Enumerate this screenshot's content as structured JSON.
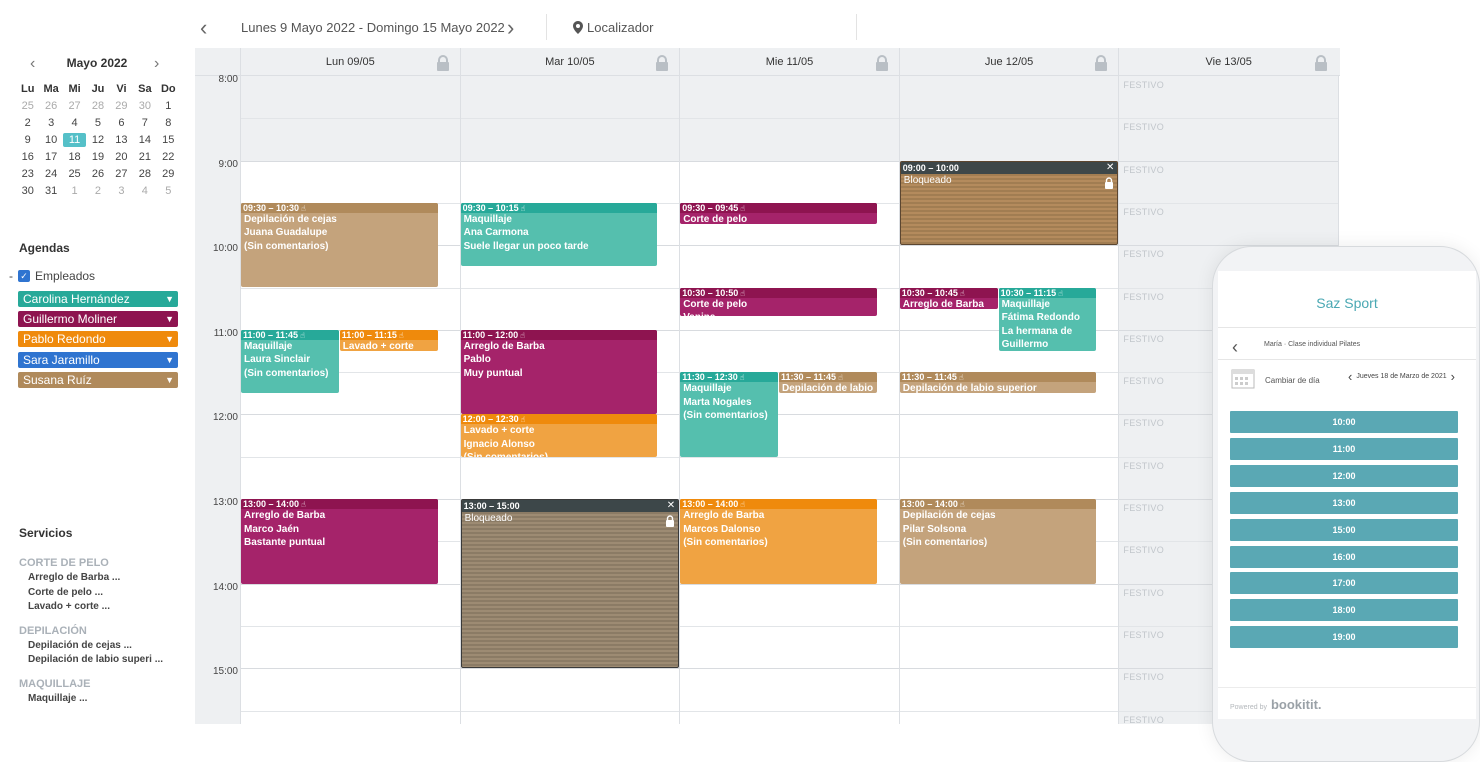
{
  "topbar": {
    "range": "Lunes 9 Mayo 2022 - Domingo 15 Mayo 2022",
    "locator": "Localizador"
  },
  "mini_calendar": {
    "month": "Mayo 2022",
    "weekdays": [
      "Lu",
      "Ma",
      "Mi",
      "Ju",
      "Vi",
      "Sa",
      "Do"
    ],
    "weeks": [
      [
        "25",
        "26",
        "27",
        "28",
        "29",
        "30",
        "1"
      ],
      [
        "2",
        "3",
        "4",
        "5",
        "6",
        "7",
        "8"
      ],
      [
        "9",
        "10",
        "11",
        "12",
        "13",
        "14",
        "15"
      ],
      [
        "16",
        "17",
        "18",
        "19",
        "20",
        "21",
        "22"
      ],
      [
        "23",
        "24",
        "25",
        "26",
        "27",
        "28",
        "29"
      ],
      [
        "30",
        "31",
        "1",
        "2",
        "3",
        "4",
        "5"
      ]
    ],
    "selected": "11"
  },
  "agendas": {
    "title": "Agendas",
    "group_label": "Empleados",
    "employees": [
      {
        "name": "Carolina Hernández",
        "color": "#27a999"
      },
      {
        "name": "Guillermo Moliner",
        "color": "#8e1450"
      },
      {
        "name": "Pablo Redondo",
        "color": "#ef8a0c"
      },
      {
        "name": "Sara Jaramillo",
        "color": "#2f74d0"
      },
      {
        "name": "Susana Ruíz",
        "color": "#b08a5b"
      }
    ]
  },
  "services": {
    "title": "Servicios",
    "categories": [
      {
        "name": "CORTE DE PELO",
        "items": [
          "Arreglo de Barba ...",
          "Corte de pelo ...",
          "Lavado + corte ..."
        ]
      },
      {
        "name": "DEPILACIÓN",
        "items": [
          "Depilación de cejas ...",
          "Depilación de labio superi ..."
        ]
      },
      {
        "name": "MAQUILLAJE",
        "items": [
          "Maquillaje ..."
        ]
      }
    ]
  },
  "calendar": {
    "days": [
      "Lun 09/05",
      "Mar 10/05",
      "Mie 11/05",
      "Jue 12/05",
      "Vie 13/05"
    ],
    "hours": [
      "8:00",
      "9:00",
      "10:00",
      "11:00",
      "12:00",
      "13:00",
      "14:00",
      "15:00"
    ],
    "festivo_label": "FESTIVO",
    "blocked_label": "Bloqueado",
    "events": [
      {
        "day": 0,
        "start": 9.5,
        "end": 10.5,
        "col": 0,
        "cols": 1,
        "time": "09:30 – 10:30",
        "lines": [
          "Depilación de cejas",
          "Juana Guadalupe",
          "(Sin comentarios)"
        ],
        "color": "#c4a37c",
        "head": "#b08a5b"
      },
      {
        "day": 0,
        "start": 11.0,
        "end": 11.75,
        "col": 0,
        "cols": 2,
        "time": "11:00 – 11:45",
        "lines": [
          "Maquillaje",
          "Laura Sinclair",
          "(Sin comentarios)"
        ],
        "color": "#55bfae",
        "head": "#27a999"
      },
      {
        "day": 0,
        "start": 11.0,
        "end": 11.25,
        "col": 1,
        "cols": 2,
        "time": "11:00 – 11:15",
        "lines": [
          "Lavado + corte"
        ],
        "color": "#f0a342",
        "head": "#ef8a0c"
      },
      {
        "day": 0,
        "start": 13.0,
        "end": 14.0,
        "col": 0,
        "cols": 1,
        "time": "13:00 – 14:00",
        "lines": [
          "Arreglo de Barba",
          "Marco Jaén",
          "Bastante puntual"
        ],
        "color": "#a5236a",
        "head": "#8e1450"
      },
      {
        "day": 1,
        "start": 9.5,
        "end": 10.25,
        "col": 0,
        "cols": 1,
        "time": "09:30 – 10:15",
        "lines": [
          "Maquillaje",
          "Ana Carmona",
          "Suele llegar un poco tarde"
        ],
        "color": "#55bfae",
        "head": "#27a999"
      },
      {
        "day": 1,
        "start": 11.0,
        "end": 12.0,
        "col": 0,
        "cols": 1,
        "time": "11:00 – 12:00",
        "lines": [
          "Arreglo de Barba",
          "Pablo",
          "Muy puntual"
        ],
        "color": "#a5236a",
        "head": "#8e1450"
      },
      {
        "day": 1,
        "start": 12.0,
        "end": 12.5,
        "col": 0,
        "cols": 1,
        "time": "12:00 – 12:30",
        "lines": [
          "Lavado + corte",
          "Ignacio Alonso",
          "(Sin comentarios)"
        ],
        "color": "#f0a342",
        "head": "#ef8a0c"
      },
      {
        "day": 2,
        "start": 9.5,
        "end": 9.75,
        "col": 0,
        "cols": 1,
        "time": "09:30 – 09:45",
        "lines": [
          "Corte de pelo"
        ],
        "color": "#a5236a",
        "head": "#8e1450"
      },
      {
        "day": 2,
        "start": 10.5,
        "end": 10.833,
        "col": 0,
        "cols": 1,
        "time": "10:30 – 10:50",
        "lines": [
          "Corte de pelo",
          "Vanina"
        ],
        "color": "#a5236a",
        "head": "#8e1450"
      },
      {
        "day": 2,
        "start": 11.5,
        "end": 12.5,
        "col": 0,
        "cols": 2,
        "time": "11:30 – 12:30",
        "lines": [
          "Maquillaje",
          "Marta Nogales",
          "(Sin comentarios)"
        ],
        "color": "#55bfae",
        "head": "#27a999"
      },
      {
        "day": 2,
        "start": 11.5,
        "end": 11.75,
        "col": 1,
        "cols": 2,
        "time": "11:30 – 11:45",
        "lines": [
          "Depilación de labio"
        ],
        "color": "#c4a37c",
        "head": "#b08a5b"
      },
      {
        "day": 2,
        "start": 13.0,
        "end": 14.0,
        "col": 0,
        "cols": 1,
        "time": "13:00 – 14:00",
        "lines": [
          "Arreglo de Barba",
          "Marcos Dalonso",
          "(Sin comentarios)"
        ],
        "color": "#f0a342",
        "head": "#ef8a0c"
      },
      {
        "day": 3,
        "start": 10.5,
        "end": 10.75,
        "col": 0,
        "cols": 2,
        "time": "10:30 – 10:45",
        "lines": [
          "Arreglo de Barba"
        ],
        "color": "#a5236a",
        "head": "#8e1450"
      },
      {
        "day": 3,
        "start": 10.5,
        "end": 11.25,
        "col": 1,
        "cols": 2,
        "time": "10:30 – 11:15",
        "lines": [
          "Maquillaje",
          "Fátima Redondo",
          "La hermana de",
          "Guillermo"
        ],
        "color": "#55bfae",
        "head": "#27a999"
      },
      {
        "day": 3,
        "start": 11.5,
        "end": 11.75,
        "col": 0,
        "cols": 1,
        "time": "11:30 – 11:45",
        "lines": [
          "Depilación de labio superior"
        ],
        "color": "#c4a37c",
        "head": "#b08a5b"
      },
      {
        "day": 3,
        "start": 13.0,
        "end": 14.0,
        "col": 0,
        "cols": 1,
        "time": "13:00 – 14:00",
        "lines": [
          "Depilación de cejas",
          "Pilar Solsona",
          "(Sin comentarios)"
        ],
        "color": "#c4a37c",
        "head": "#b08a5b"
      }
    ],
    "blocks": [
      {
        "day": 3,
        "start": 9.0,
        "end": 10.0,
        "time": "09:00 – 10:00",
        "style": "blk"
      },
      {
        "day": 1,
        "start": 13.0,
        "end": 15.0,
        "time": "13:00 – 15:00",
        "style": "blk2"
      }
    ]
  },
  "phone": {
    "brand": "Saz Sport",
    "breadcrumb": "María · Clase individual Pilates",
    "change_day": "Cambiar de día",
    "date": "Jueves 18 de Marzo de 2021",
    "slots": [
      "10:00",
      "11:00",
      "12:00",
      "13:00",
      "15:00",
      "16:00",
      "17:00",
      "18:00",
      "19:00"
    ],
    "powered_by": "Powered by",
    "powered_brand": "bookitit."
  }
}
